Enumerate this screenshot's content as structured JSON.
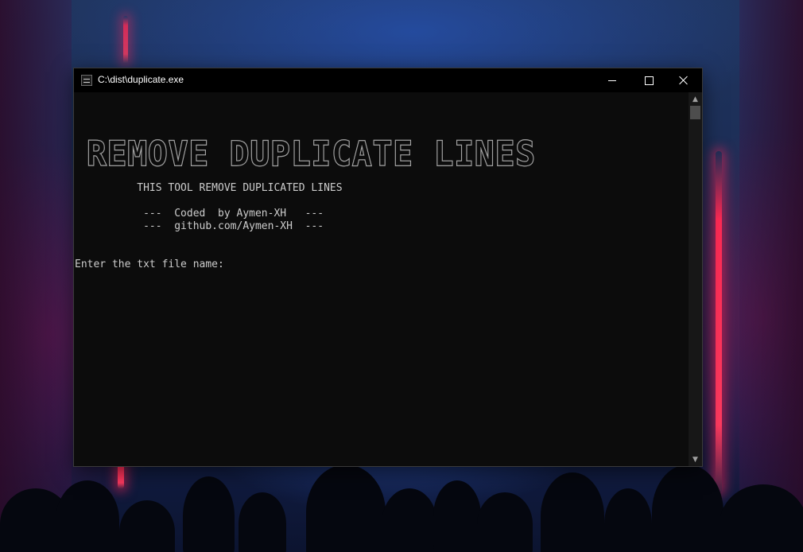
{
  "window": {
    "title": "C:\\dist\\duplicate.exe",
    "icon": "console-app-icon",
    "controls": {
      "minimize": "minimize-icon",
      "maximize": "maximize-icon",
      "close": "close-icon"
    }
  },
  "console": {
    "banner": "REMOVE DUPLICATE LINES",
    "lines": [
      "          THIS TOOL REMOVE DUPLICATED LINES",
      "           ---  Coded  by Aymen-XH   ---",
      "           ---  github.com/Aymen-XH  ---",
      "Enter the txt file name:"
    ]
  },
  "colors": {
    "console_bg": "#0c0c0c",
    "console_text": "#cccccc",
    "titlebar_bg": "#000000",
    "accent_beam": "#ff2a55"
  }
}
